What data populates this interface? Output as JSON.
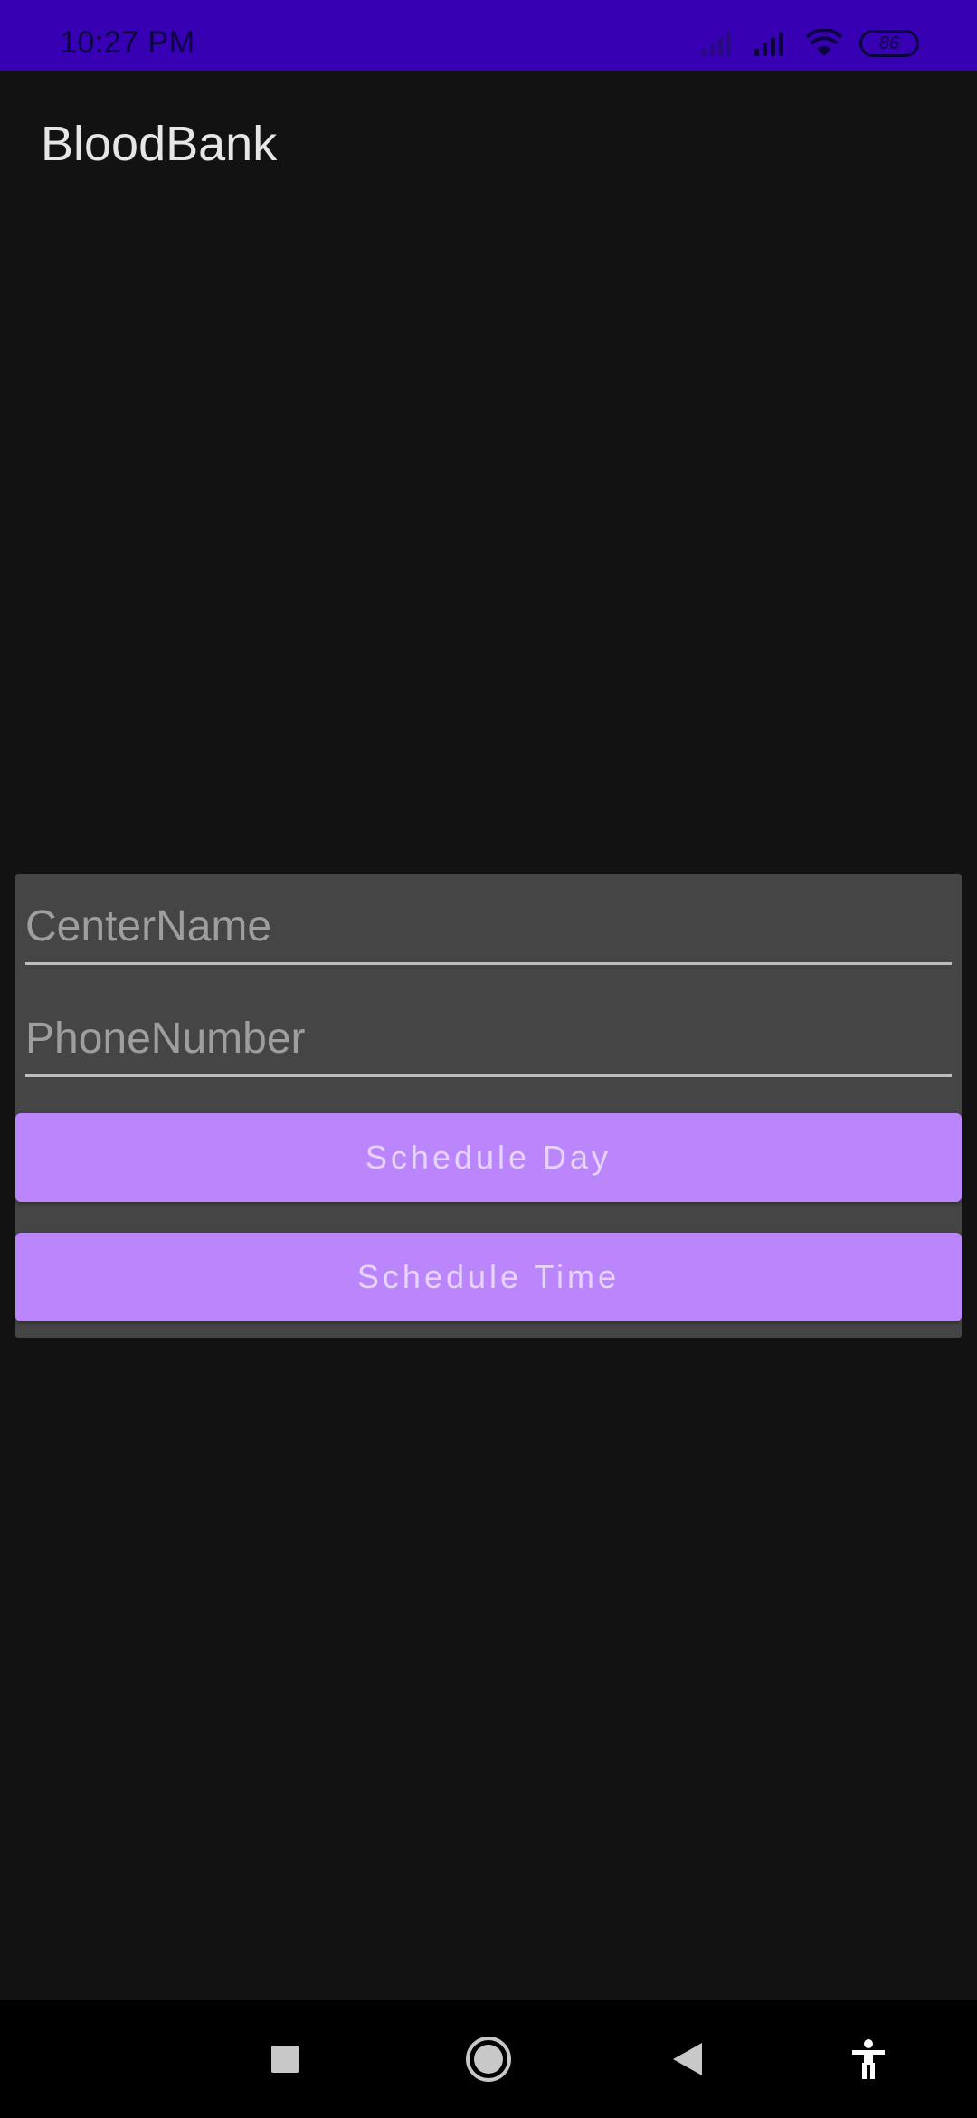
{
  "status_bar": {
    "time": "10:27 PM",
    "battery": "86",
    "icons": [
      "signal-weak-icon",
      "signal-icon",
      "wifi-icon",
      "battery-icon"
    ]
  },
  "app_bar": {
    "title": "BloodBank"
  },
  "form": {
    "center_name": {
      "value": "",
      "placeholder": "CenterName"
    },
    "phone_number": {
      "value": "",
      "placeholder": "PhoneNumber"
    },
    "schedule_day_label": "Schedule Day",
    "schedule_time_label": "Schedule Time"
  },
  "nav_bar": {
    "icons": [
      "recents-square-icon",
      "home-circle-icon",
      "back-triangle-icon",
      "accessibility-icon"
    ]
  },
  "colors": {
    "status_bar": "#3700b3",
    "background": "#121212",
    "card": "#454545",
    "button": "#bb86fc"
  }
}
